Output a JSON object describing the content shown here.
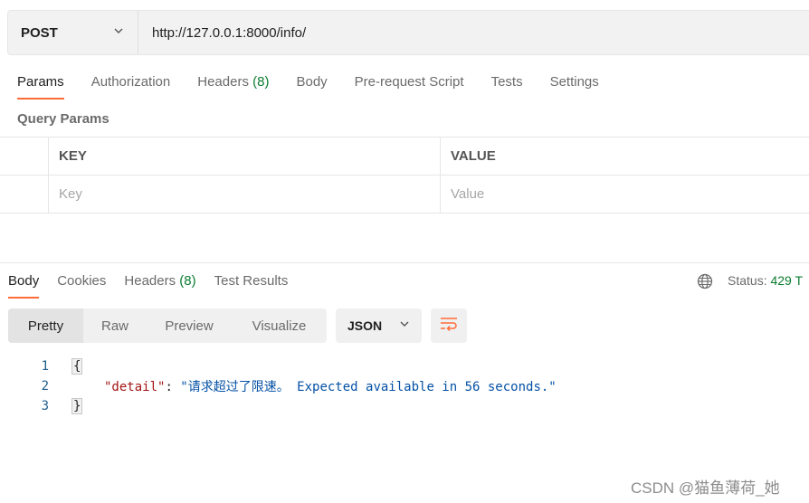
{
  "request": {
    "method": "POST",
    "url": "http://127.0.0.1:8000/info/"
  },
  "request_tabs": [
    {
      "label": "Params",
      "count": ""
    },
    {
      "label": "Authorization",
      "count": ""
    },
    {
      "label": "Headers",
      "count": "(8)"
    },
    {
      "label": "Body",
      "count": ""
    },
    {
      "label": "Pre-request Script",
      "count": ""
    },
    {
      "label": "Tests",
      "count": ""
    },
    {
      "label": "Settings",
      "count": ""
    }
  ],
  "query_params": {
    "title": "Query Params",
    "columns": {
      "key": "KEY",
      "value": "VALUE"
    },
    "placeholders": {
      "key": "Key",
      "value": "Value"
    }
  },
  "response_tabs": [
    {
      "label": "Body",
      "count": ""
    },
    {
      "label": "Cookies",
      "count": ""
    },
    {
      "label": "Headers",
      "count": "(8)"
    },
    {
      "label": "Test Results",
      "count": ""
    }
  ],
  "status": {
    "label": "Status:",
    "code": "429 T"
  },
  "view_modes": [
    "Pretty",
    "Raw",
    "Preview",
    "Visualize"
  ],
  "format": "JSON",
  "icons": {
    "method_dropdown": "chevron-down-icon",
    "format_dropdown": "chevron-down-icon",
    "wrap": "wrap-lines-icon",
    "globe": "globe-icon"
  },
  "colors": {
    "accent": "#ff6c37",
    "count_green": "#0a7d2f",
    "json_key": "#a31515",
    "json_string": "#0451a5"
  },
  "code": {
    "lines": [
      {
        "num": "1",
        "open": "{"
      },
      {
        "num": "2",
        "key": "\"detail\"",
        "sep": ": ",
        "value": "\"请求超过了限速。 Expected available in 56 seconds.\""
      },
      {
        "num": "3",
        "close": "}"
      }
    ]
  },
  "watermark": "CSDN @猫鱼薄荷_她"
}
